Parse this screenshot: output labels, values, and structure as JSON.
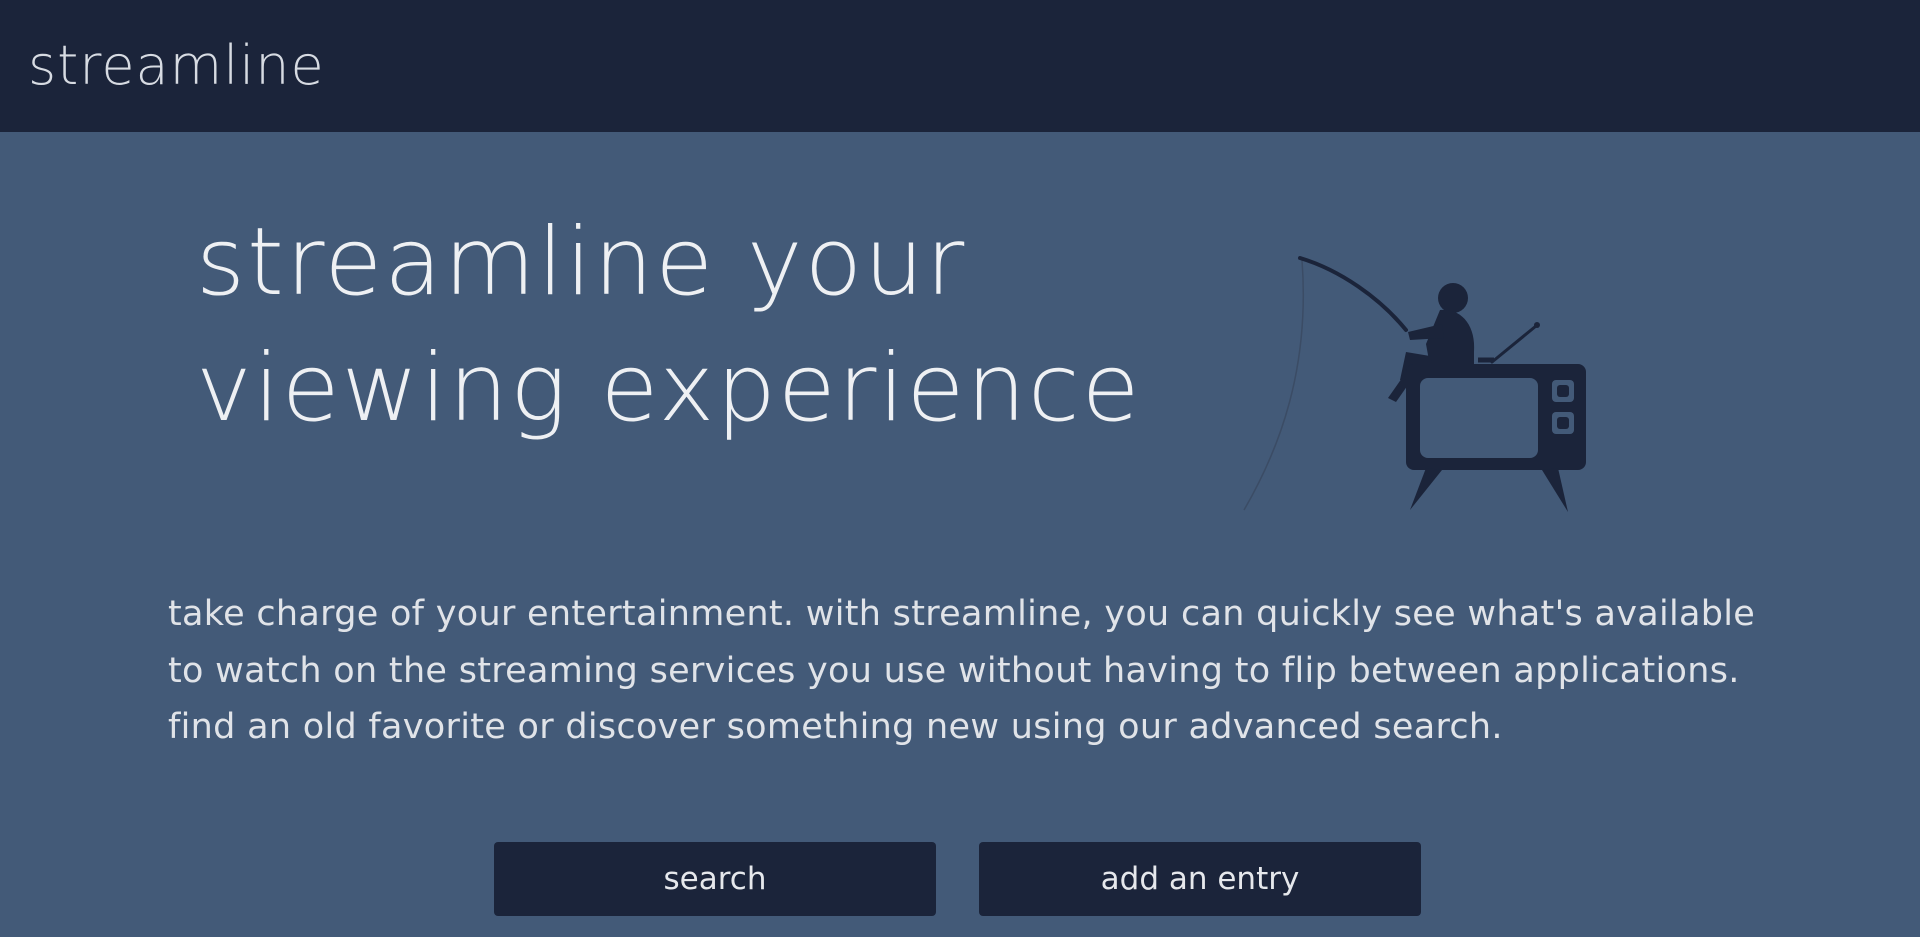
{
  "navbar": {
    "brand": "streamline"
  },
  "hero": {
    "title": "streamline your viewing experience",
    "illustration": "fisher-on-tv-icon",
    "description": "take charge of your entertainment. with streamline, you can quickly see what's available to watch on the streaming services you use without having to flip between applications. find an old favorite or discover something new using our advanced search."
  },
  "actions": {
    "search_label": "search",
    "add_label": "add an entry"
  },
  "colors": {
    "navbar_bg": "#1b243a",
    "page_bg": "#435a78",
    "button_bg": "#1b243a",
    "text_light": "#eef0f3",
    "illustration": "#1b243a"
  }
}
